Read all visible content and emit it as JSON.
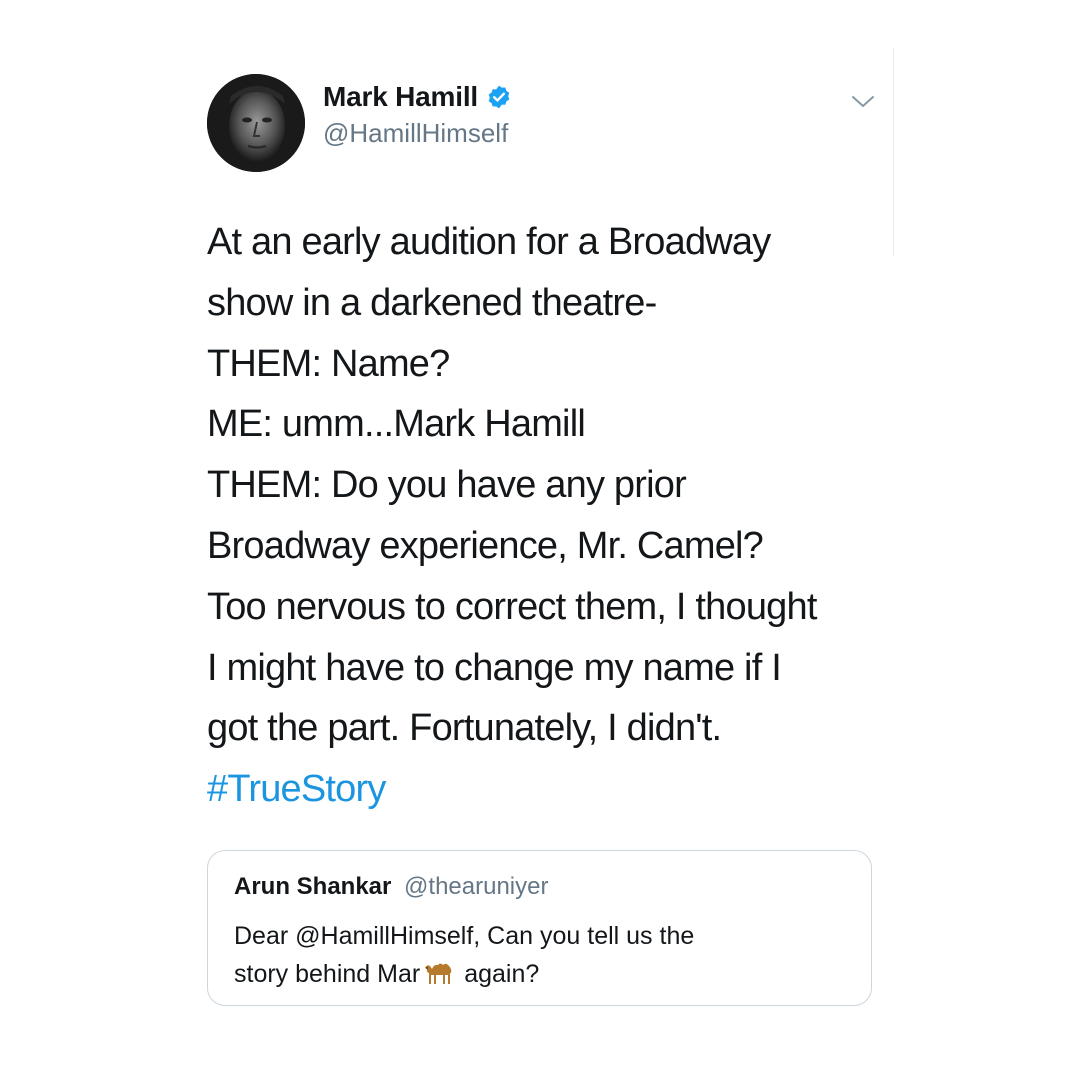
{
  "author": {
    "display_name": "Mark Hamill",
    "handle": "@HamillHimself",
    "verified": true,
    "avatar_icon": "avatar-photo"
  },
  "menu": {
    "icon": "chevron-down-icon"
  },
  "tweet": {
    "lines": [
      "At an early audition for a Broadway",
      "show in a darkened theatre-",
      "THEM: Name?",
      "ME: umm...Mark Hamill",
      "THEM: Do you have any prior",
      "Broadway experience, Mr. Camel?",
      "Too nervous to correct them, I thought",
      "I might have to change my name if I",
      "got the part. Fortunately, I didn't."
    ],
    "hashtag": "#TrueStory"
  },
  "quoted_tweet": {
    "display_name": "Arun Shankar",
    "handle": "@thearuniyer",
    "line1": "Dear @HamillHimself, Can you tell us the",
    "line2_before_emoji": "story behind Mar",
    "emoji_icon": "camel-icon",
    "line2_after_emoji": "again?"
  },
  "colors": {
    "text": "#14171a",
    "secondary": "#657786",
    "link": "#1b95e0",
    "verified": "#1da1f2",
    "border": "#ccd6dd"
  }
}
